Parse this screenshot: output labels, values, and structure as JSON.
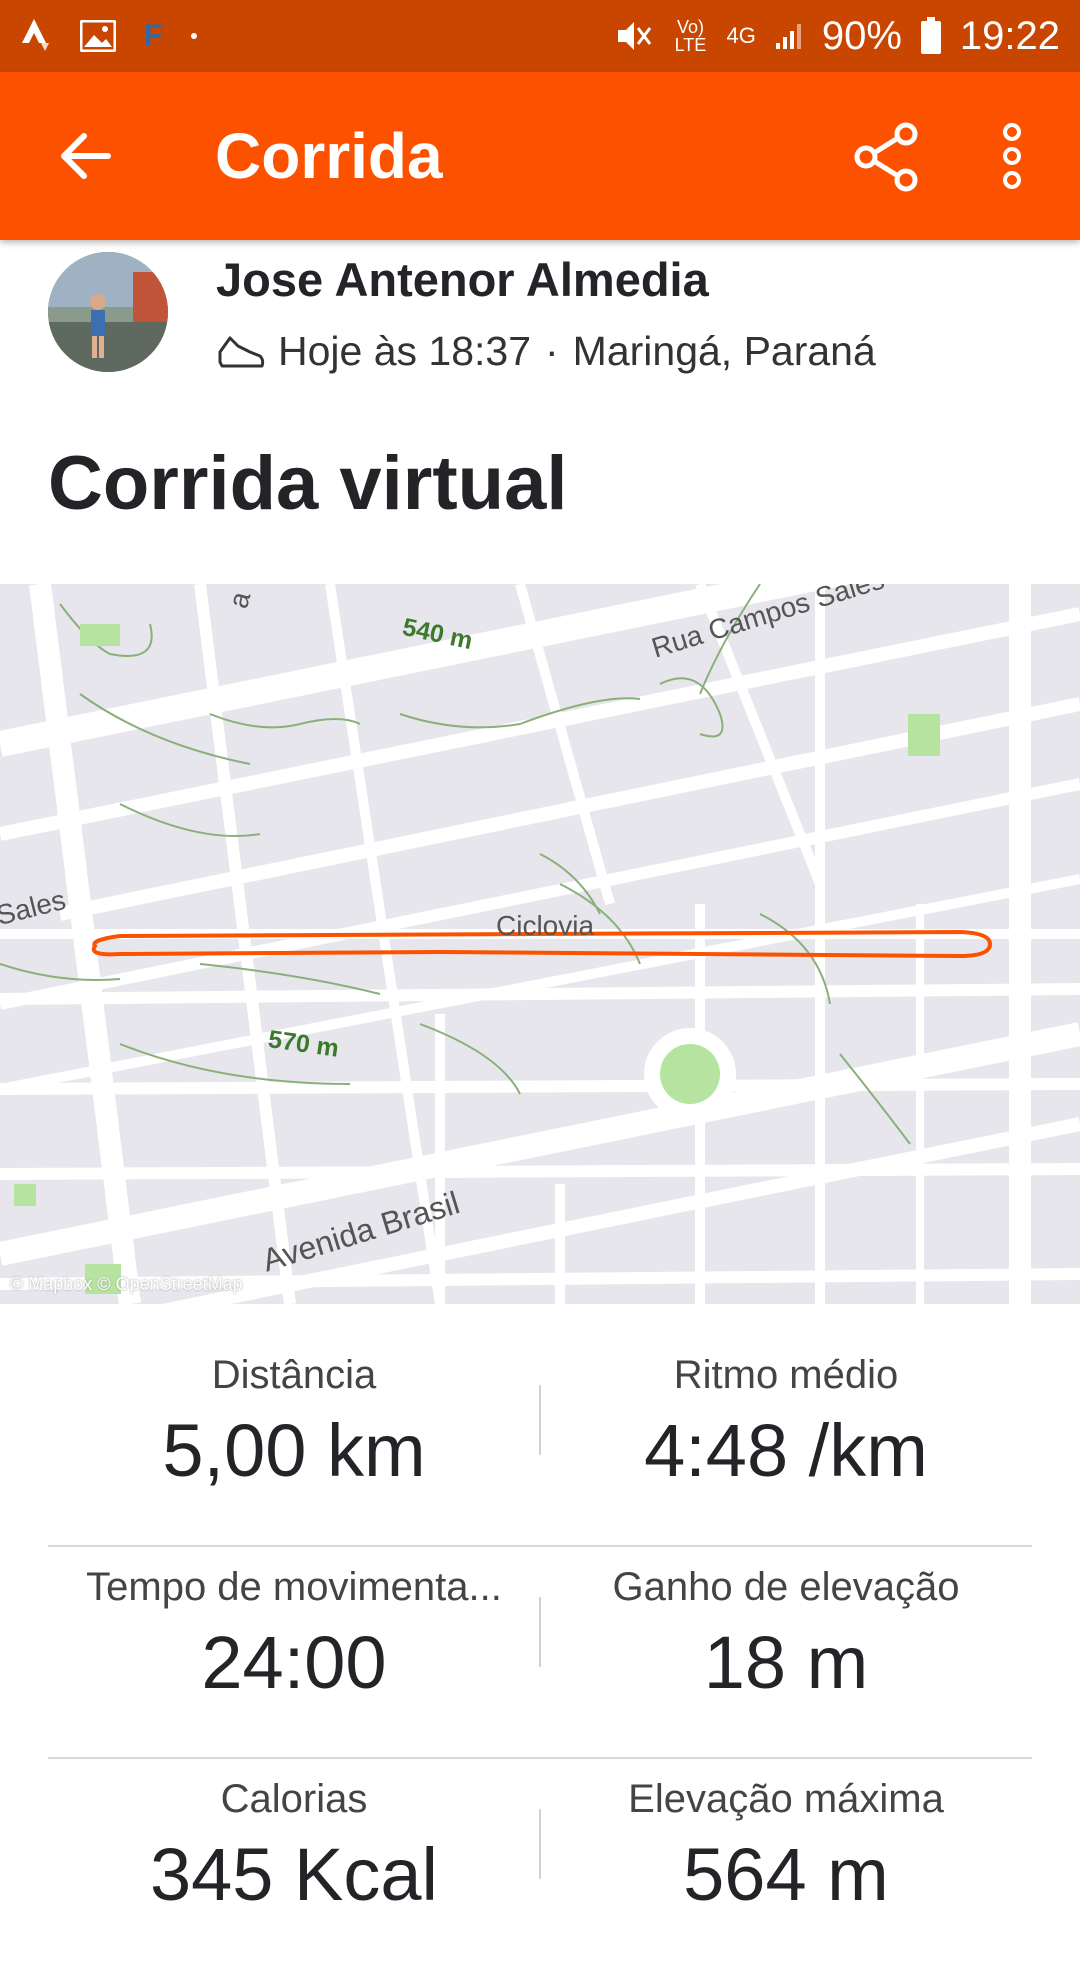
{
  "status_bar": {
    "battery": "90%",
    "time": "19:22",
    "volte_label": "Vo) LTE",
    "network_label": "4G",
    "notification_letter": "F"
  },
  "app_bar": {
    "title": "Corrida",
    "back_icon": "arrow-left-icon",
    "share_icon": "share-icon",
    "more_icon": "more-vert-icon",
    "background": "#fc5200"
  },
  "athlete": {
    "name": "Jose Antenor Almedia",
    "time_text": "Hoje às 18:37",
    "separator": "·",
    "location": "Maringá, Paraná"
  },
  "activity": {
    "title": "Corrida virtual"
  },
  "map": {
    "labels": {
      "rua_campos_sales": "Rua Campos Sales",
      "sales": "Sales",
      "ciclovia": "Ciclovia",
      "avenida_brasil": "Avenida Brasil",
      "elev_540": "540 m",
      "elev_570": "570 m",
      "attribution": "© Mapbox © OpenStreetMap",
      "fragment": "a"
    },
    "route_color": "#fc5200"
  },
  "stats": [
    {
      "left": {
        "label": "Distância",
        "value": "5,00 km"
      },
      "right": {
        "label": "Ritmo médio",
        "value": "4:48 /km"
      }
    },
    {
      "left": {
        "label": "Tempo de movimenta...",
        "value": "24:00"
      },
      "right": {
        "label": "Ganho de elevação",
        "value": "18 m"
      }
    },
    {
      "left": {
        "label": "Calorias",
        "value": "345 Kcal"
      },
      "right": {
        "label": "Elevação máxima",
        "value": "564 m"
      }
    }
  ]
}
